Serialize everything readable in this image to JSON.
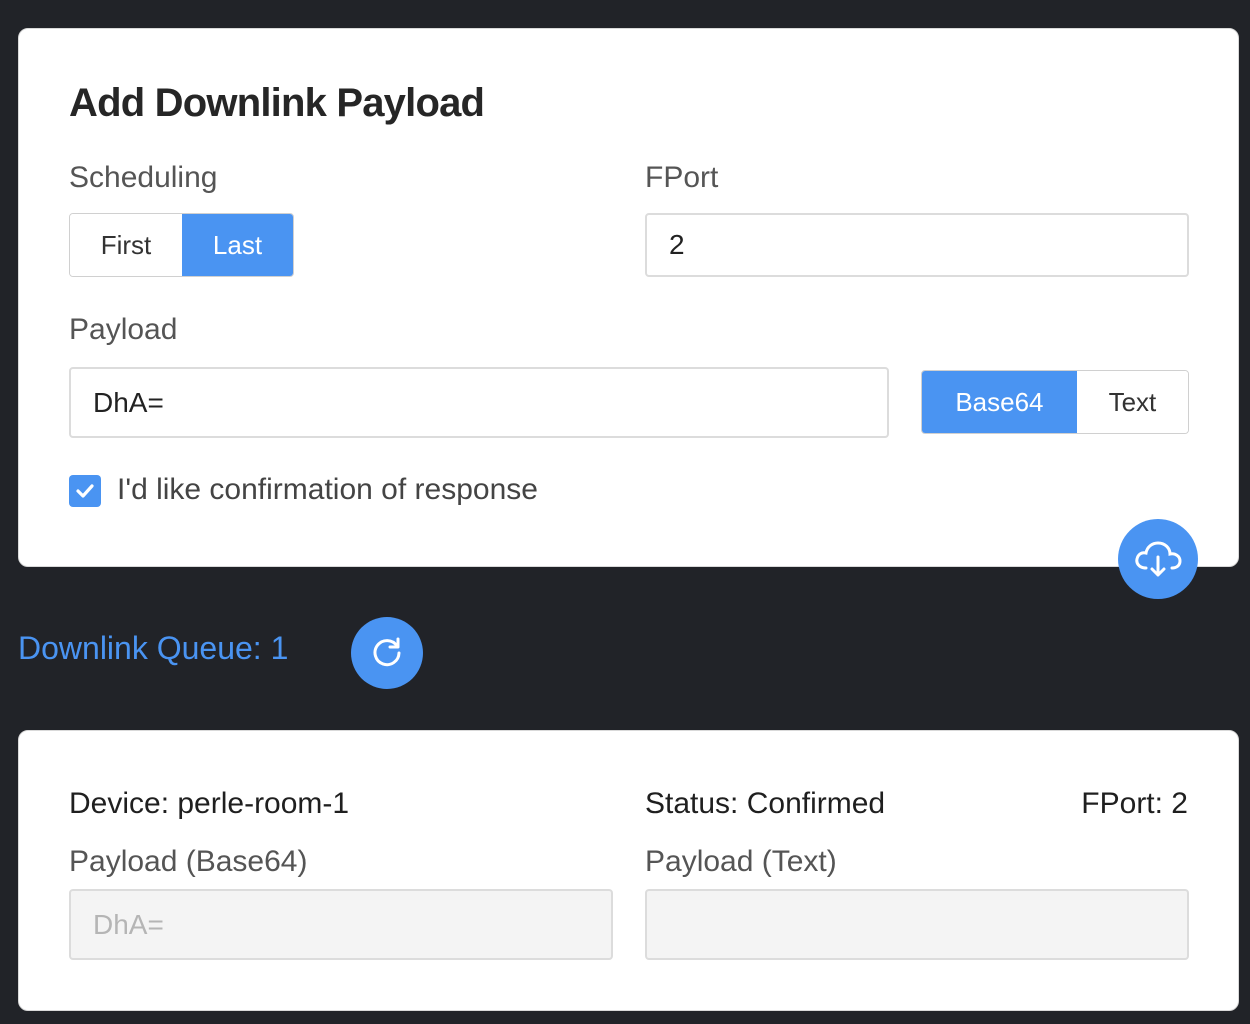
{
  "add": {
    "title": "Add Downlink Payload",
    "scheduling_label": "Scheduling",
    "scheduling_options": [
      "First",
      "Last"
    ],
    "scheduling_selected": "Last",
    "fport_label": "FPort",
    "fport_value": "2",
    "payload_label": "Payload",
    "payload_value": "DhA=",
    "encoding_options": [
      "Base64",
      "Text"
    ],
    "encoding_selected": "Base64",
    "confirm_label": "I'd like confirmation of response",
    "confirm_checked": true,
    "submit_icon": "cloud-download-icon"
  },
  "queue": {
    "title": "Downlink Queue: 1",
    "refresh_icon": "refresh-icon",
    "item": {
      "device": "Device: perle-room-1",
      "status": "Status: Confirmed",
      "fport": "FPort: 2",
      "payload_b64_label": "Payload (Base64)",
      "payload_b64_value": "DhA=",
      "payload_text_label": "Payload (Text)",
      "payload_text_value": ""
    }
  },
  "colors": {
    "accent": "#4a94f2",
    "background": "#212328",
    "card": "#ffffff"
  }
}
